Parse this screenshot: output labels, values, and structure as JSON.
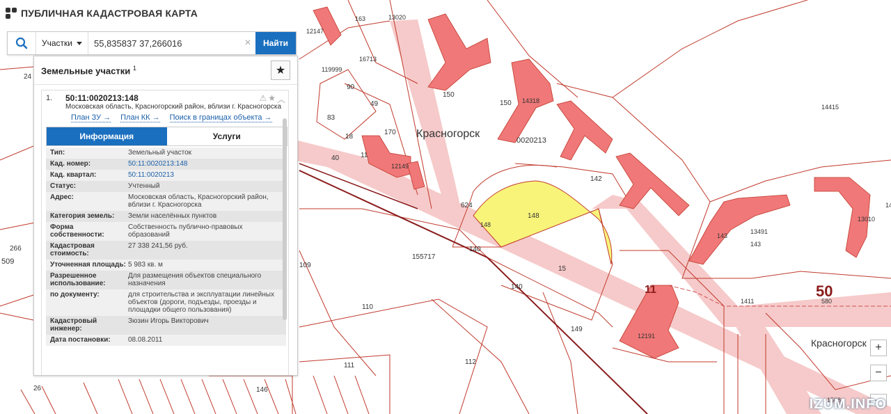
{
  "app": {
    "title": "ПУБЛИЧНАЯ КАДАСТРОВАЯ КАРТА"
  },
  "search": {
    "type_label": "Участки",
    "query": "55,835837 37,266016",
    "find_label": "Найти",
    "clear": "×"
  },
  "panel": {
    "title": "Земельные участки",
    "count": "1",
    "result": {
      "num": "1.",
      "id": "50:11:0020213:148",
      "address": "Московская область, Красногорский район, вблизи г. Красногорска",
      "links": [
        "План ЗУ →",
        "План КК →",
        "Поиск в границах объекта →"
      ],
      "tabs": [
        "Информация",
        "Услуги"
      ],
      "attributes": [
        {
          "k": "Тип:",
          "v": "Земельный участок"
        },
        {
          "k": "Кад. номер:",
          "v": "50:11:0020213:148",
          "link": true
        },
        {
          "k": "Кад. квартал:",
          "v": "50:11:0020213",
          "link": true
        },
        {
          "k": "Статус:",
          "v": "Учтенный"
        },
        {
          "k": "Адрес:",
          "v": "Московская область, Красногорский район, вблизи г. Красногорска"
        },
        {
          "k": "Категория земель:",
          "v": "Земли населённых пунктов"
        },
        {
          "k": "Форма собственности:",
          "v": "Собственность публично-правовых образований"
        },
        {
          "k": "Кадастровая стоимость:",
          "v": "27 338 241,56 руб."
        },
        {
          "k": "Уточненная площадь:",
          "v": "5 983 кв. м"
        },
        {
          "k": "Разрешенное использование:",
          "v": "Для размещения объектов специального назначения"
        },
        {
          "k": "по документу:",
          "v": "для строительства и эксплуатации линейных объектов (дороги, подъезды, проезды и площадки общего пользования)"
        },
        {
          "k": "Кадастровый инженер:",
          "v": "Зюзин Игорь Викторович"
        },
        {
          "k": "Дата постановки:",
          "v": "08.08.2011"
        }
      ]
    }
  },
  "map": {
    "labels": [
      "Красногорск",
      "0020213",
      "Красногорск",
      "50",
      "11",
      "11",
      "155717",
      "14415",
      "142",
      "150",
      "150",
      "624",
      "148",
      "148",
      "140",
      "140",
      "15",
      "149",
      "110",
      "109",
      "111",
      "112",
      "170",
      "83",
      "18",
      "40",
      "49",
      "90",
      "13",
      "266",
      "509",
      "26",
      "24",
      "119999",
      "16713",
      "163",
      "13020",
      "12147",
      "12191",
      "14318",
      "143",
      "143",
      "1411",
      "580",
      "146",
      "147",
      "13491",
      "13010",
      "1508",
      "12149"
    ],
    "zoom_in": "+",
    "zoom_out": "−",
    "more": "⋯"
  },
  "colors": {
    "building": "#f07878",
    "selected_parcel": "#f8f47a",
    "parcel_line": "#c0392b",
    "accent": "#1a6fbf"
  },
  "watermark": "IZUM.INFO"
}
